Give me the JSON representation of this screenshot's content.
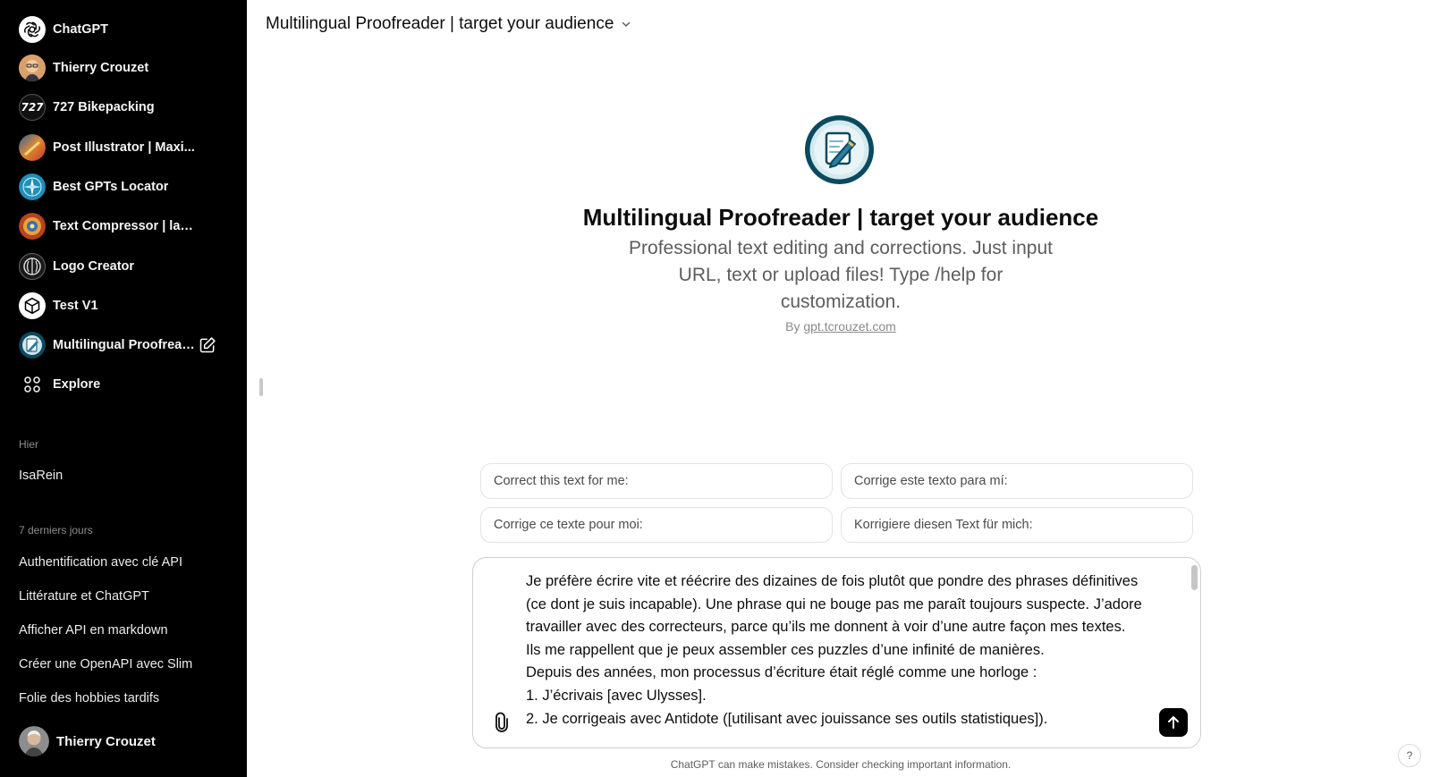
{
  "sidebar": {
    "gpts": [
      {
        "label": "ChatGPT",
        "icon": "openai-logo-icon"
      },
      {
        "label": "Thierry Crouzet",
        "icon": "portrait-avatar-icon"
      },
      {
        "label": "727 Bikepacking",
        "icon": "727-logo-icon"
      },
      {
        "label": "Post Illustrator | Maxi...",
        "icon": "illustration-avatar-icon"
      },
      {
        "label": "Best GPTs Locator",
        "icon": "compass-avatar-icon"
      },
      {
        "label": "Text Compressor | lan...",
        "icon": "compressor-avatar-icon"
      },
      {
        "label": "Logo Creator",
        "icon": "logo-creator-avatar-icon"
      },
      {
        "label": "Test V1",
        "icon": "cube-icon"
      },
      {
        "label": "Multilingual Proofread...",
        "icon": "proofreader-avatar-icon"
      }
    ],
    "explore_label": "Explore",
    "section_yesterday": "Hier",
    "yesterday_items": [
      "IsaRein"
    ],
    "section_week": "7 derniers jours",
    "week_items": [
      "Authentification avec clé API",
      "Littérature et ChatGPT",
      "Afficher API en markdown",
      "Créer une OpenAPI avec Slim",
      "Folie des hobbies tardifs"
    ],
    "user_name": "Thierry Crouzet"
  },
  "header": {
    "title": "Multilingual Proofreader | target your audience"
  },
  "hero": {
    "title": "Multilingual Proofreader | target your audience",
    "description": "Professional text editing and corrections. Just input URL, text or upload files! Type /help for customization.",
    "by_prefix": "By",
    "by_link": "gpt.tcrouzet.com"
  },
  "starters": [
    "Correct this text for me:",
    "Corrige este texto para mí:",
    "Corrige ce texte pour moi:",
    "Korrigiere diesen Text für mich:"
  ],
  "composer": {
    "lines": [
      "Je préfère écrire vite et réécrire des dizaines de fois plutôt que pondre des phrases définitives (ce dont je suis incapable). Une phrase qui ne bouge pas me paraît toujours suspecte. J’adore travailler avec des correcteurs, parce qu’ils me donnent à voir d’une autre façon mes textes. Ils me rappellent que je peux assembler ces puzzles d’une infinité de manières.",
      "Depuis des années, mon processus d’écriture était réglé comme une horloge :",
      "1. J’écrivais [avec Ulysses].",
      "2. Je corrigeais avec Antidote ([utilisant avec jouissance ses outils statistiques])."
    ]
  },
  "footer": {
    "disclaimer": "ChatGPT can make mistakes. Consider checking important information.",
    "help": "?"
  },
  "colors": {
    "sidebar_bg": "#000000",
    "send_button": "#000000",
    "logo_ring": "#0b4a5e"
  }
}
